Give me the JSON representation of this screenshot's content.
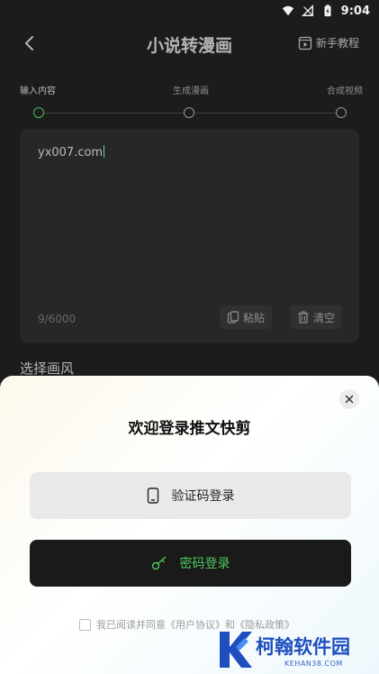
{
  "status_bar": {
    "time": "9:04"
  },
  "header": {
    "title": "小说转漫画",
    "tutorial_label": "新手教程"
  },
  "steps": [
    {
      "label": "输入内容",
      "active": true
    },
    {
      "label": "生成漫画",
      "active": false
    },
    {
      "label": "合成视频",
      "active": false
    }
  ],
  "editor": {
    "text": "yx007.com",
    "counter": "9/6000",
    "paste_label": "粘贴",
    "clear_label": "清空"
  },
  "style_section": {
    "label": "选择画风"
  },
  "login_sheet": {
    "title": "欢迎登录推文快剪",
    "code_login_label": "验证码登录",
    "password_login_label": "密码登录",
    "agreement_text": "我已阅读并同意《用户协议》和《隐私政策》"
  },
  "watermark": {
    "text": "柯翰软件园",
    "url": "KEHAN38.COM"
  },
  "colors": {
    "accent_green": "#4fbb5a",
    "background": "#1b1d1c",
    "watermark_blue": "#1f4fbf"
  }
}
